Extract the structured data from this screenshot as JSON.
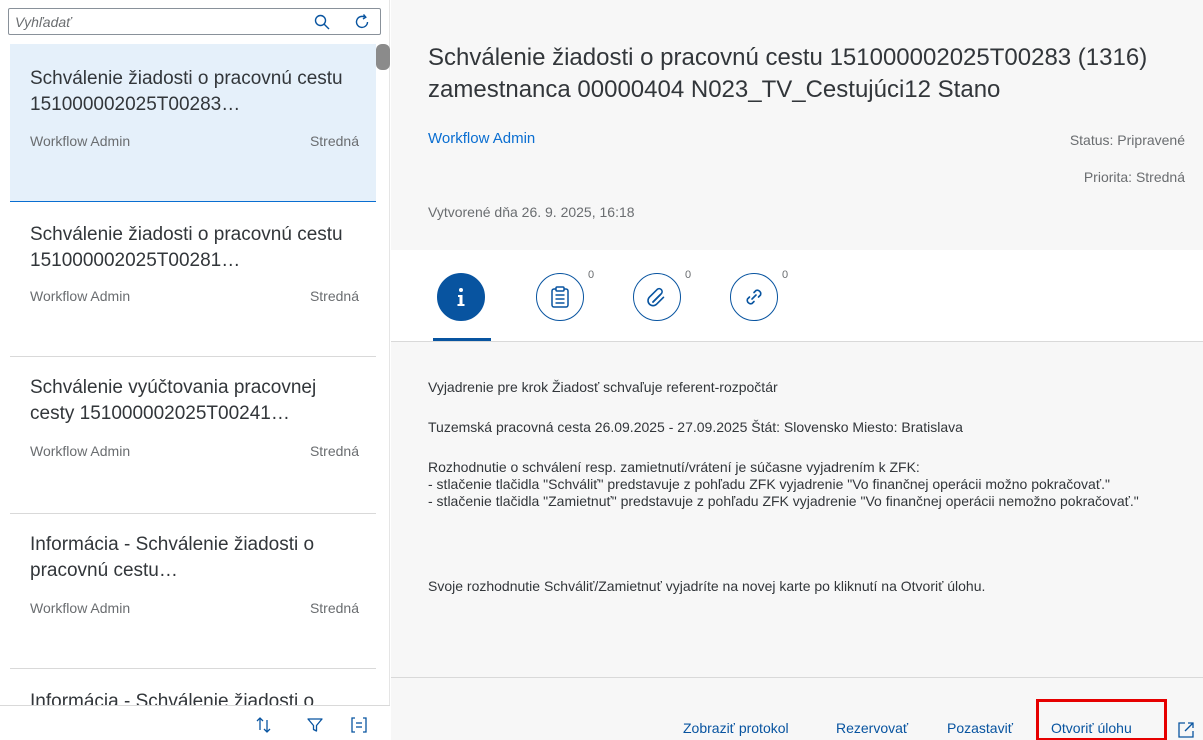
{
  "search": {
    "placeholder": "Vyhľadať"
  },
  "list": {
    "items": [
      {
        "title": "Schválenie žiadosti o pracovnú cestu 151000002025T00283…",
        "creator": "Workflow Admin",
        "priority": "Stredná",
        "selected": true
      },
      {
        "title": "Schválenie žiadosti o pracovnú cestu 151000002025T00281…",
        "creator": "Workflow Admin",
        "priority": "Stredná"
      },
      {
        "title": "Schválenie vyúčtovania pracovnej cesty 151000002025T00241…",
        "creator": "Workflow Admin",
        "priority": "Stredná"
      },
      {
        "title": "Informácia - Schválenie žiadosti o pracovnú cestu…",
        "creator": "Workflow Admin",
        "priority": "Stredná"
      },
      {
        "title": "Informácia - Schválenie žiadosti o"
      }
    ]
  },
  "footer_icons": [
    "sort-icon",
    "filter-icon",
    "group-icon"
  ],
  "detail": {
    "title": "Schválenie žiadosti o pracovnú cestu 151000002025T00283 (1316) zamestnanca 00000404 N023_TV_Cestujúci12 Stano",
    "creator": "Workflow Admin",
    "status": "Status: Pripravené",
    "priority": "Priorita: Stredná",
    "created": "Vytvorené dňa 26. 9. 2025, 16:18"
  },
  "tabs": [
    {
      "icon": "info-icon",
      "count": ""
    },
    {
      "icon": "notes-icon",
      "count": "0"
    },
    {
      "icon": "attachment-icon",
      "count": "0"
    },
    {
      "icon": "link-icon",
      "count": "0"
    }
  ],
  "content": {
    "p1": "Vyjadrenie pre krok Žiadosť schvaľuje referent-rozpočtár",
    "p2": "Tuzemská pracovná cesta 26.09.2025 - 27.09.2025 Štát: Slovensko Miesto: Bratislava",
    "p3": "Rozhodnutie o schválení resp. zamietnutí/vrátení je súčasne vyjadrením k ZFK:\n- stlačenie tlačidla \"Schváliť\" predstavuje z pohľadu ZFK vyjadrenie \"Vo finančnej operácii možno pokračovať.\"\n- stlačenie tlačidla \"Zamietnuť\" predstavuje z pohľadu ZFK vyjadrenie \"Vo finančnej operácii nemožno pokračovať.\"",
    "p4": "Svoje rozhodnutie Schváliť/Zamietnuť vyjadríte na novej karte po kliknutí na Otvoriť úlohu."
  },
  "actions": {
    "log": "Zobraziť protokol",
    "reserve": "Rezervovať",
    "suspend": "Pozastaviť",
    "open_task": "Otvoriť úlohu"
  },
  "colors": {
    "accent": "#0854a0",
    "link": "#0a6ed1",
    "highlight": "#e60000",
    "selected_bg": "#e5f0fa"
  }
}
